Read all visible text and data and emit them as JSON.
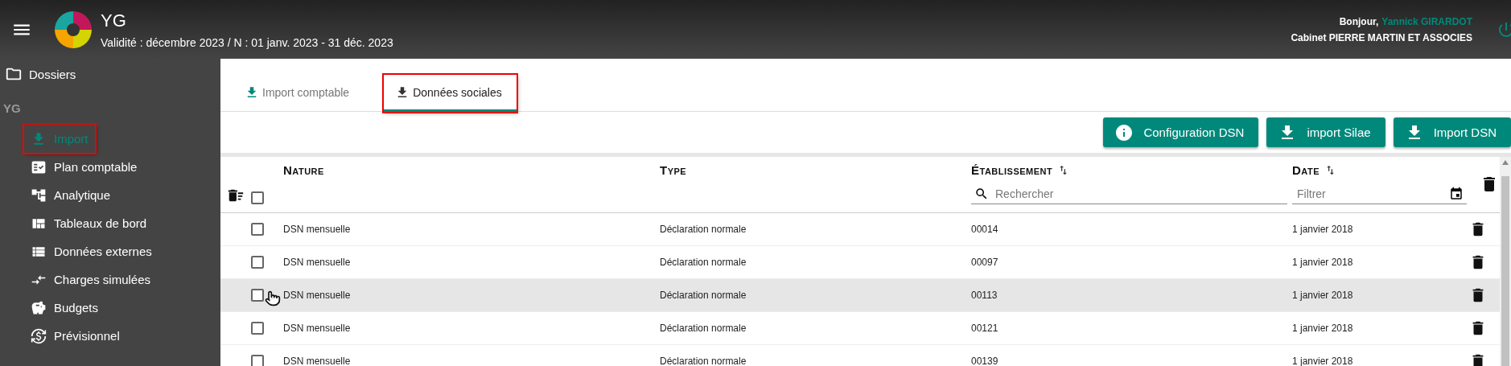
{
  "header": {
    "title": "YG",
    "subtitle": "Validité : décembre 2023 / N : 01 janv. 2023 - 31 déc. 2023",
    "greeting": "Bonjour,",
    "user": "Yannick GIRARDOT",
    "firm": "Cabinet PIERRE MARTIN ET ASSOCIES"
  },
  "sidebar": {
    "top_item": {
      "label": "Dossiers"
    },
    "section": "YG",
    "items": [
      {
        "label": "Import",
        "selected": true,
        "highlighted": true
      },
      {
        "label": "Plan comptable",
        "selected": false,
        "highlighted": false
      },
      {
        "label": "Analytique",
        "selected": false,
        "highlighted": false
      },
      {
        "label": "Tableaux de bord",
        "selected": false,
        "highlighted": false
      },
      {
        "label": "Données externes",
        "selected": false,
        "highlighted": false
      },
      {
        "label": "Charges simulées",
        "selected": false,
        "highlighted": false
      },
      {
        "label": "Budgets",
        "selected": false,
        "highlighted": false
      },
      {
        "label": "Prévisionnel",
        "selected": false,
        "highlighted": false
      }
    ]
  },
  "tabs": [
    {
      "label": "Import comptable",
      "selected": false,
      "highlighted": false
    },
    {
      "label": "Données sociales",
      "selected": true,
      "highlighted": true
    }
  ],
  "buttons": [
    {
      "label": "Configuration DSN",
      "kind": "info"
    },
    {
      "label": "import Silae",
      "kind": "download"
    },
    {
      "label": "Import DSN",
      "kind": "download"
    }
  ],
  "table": {
    "select_all_checked": false,
    "columns": [
      {
        "label": "Nature",
        "sortable": false
      },
      {
        "label": "Type",
        "sortable": false
      },
      {
        "label": "Établissement",
        "sortable": true,
        "filter": {
          "kind": "search",
          "placeholder": "Rechercher"
        }
      },
      {
        "label": "Date",
        "sortable": true,
        "filter": {
          "kind": "date",
          "placeholder": "Filtrer"
        }
      }
    ],
    "rows": [
      {
        "nature": "DSN mensuelle",
        "type": "Déclaration normale",
        "etablissement": "00014",
        "date": "1 janvier 2018",
        "checked": false,
        "hovered": false
      },
      {
        "nature": "DSN mensuelle",
        "type": "Déclaration normale",
        "etablissement": "00097",
        "date": "1 janvier 2018",
        "checked": false,
        "hovered": false
      },
      {
        "nature": "DSN mensuelle",
        "type": "Déclaration normale",
        "etablissement": "00113",
        "date": "1 janvier 2018",
        "checked": false,
        "hovered": true
      },
      {
        "nature": "DSN mensuelle",
        "type": "Déclaration normale",
        "etablissement": "00121",
        "date": "1 janvier 2018",
        "checked": false,
        "hovered": false
      },
      {
        "nature": "DSN mensuelle",
        "type": "Déclaration normale",
        "etablissement": "00139",
        "date": "1 janvier 2018",
        "checked": false,
        "hovered": false
      }
    ]
  }
}
